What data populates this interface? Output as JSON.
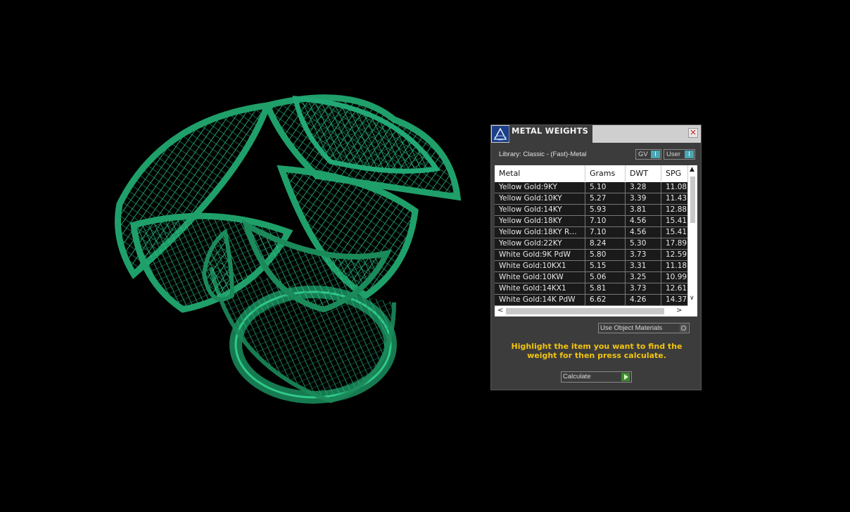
{
  "dialog": {
    "title": "METAL WEIGHTS",
    "close_glyph": "×",
    "library_label": "Library: Classic - (Fast)-Metal",
    "gv_button": "GV",
    "user_button": "User",
    "indicator_glyph": "I",
    "columns": [
      "Metal",
      "Grams",
      "DWT",
      "SPG"
    ],
    "rows": [
      {
        "metal": "Yellow Gold:9KY",
        "grams": "5.10",
        "dwt": "3.28",
        "spg": "11.08"
      },
      {
        "metal": "Yellow Gold:10KY",
        "grams": "5.27",
        "dwt": "3.39",
        "spg": "11.43"
      },
      {
        "metal": "Yellow Gold:14KY",
        "grams": "5.93",
        "dwt": "3.81",
        "spg": "12.88"
      },
      {
        "metal": "Yellow Gold:18KY",
        "grams": "7.10",
        "dwt": "4.56",
        "spg": "15.41"
      },
      {
        "metal": "Yellow Gold:18KY R…",
        "grams": "7.10",
        "dwt": "4.56",
        "spg": "15.41"
      },
      {
        "metal": "Yellow Gold:22KY",
        "grams": "8.24",
        "dwt": "5.30",
        "spg": "17.89"
      },
      {
        "metal": "White Gold:9K PdW",
        "grams": "5.80",
        "dwt": "3.73",
        "spg": "12.59"
      },
      {
        "metal": "White Gold:10KX1",
        "grams": "5.15",
        "dwt": "3.31",
        "spg": "11.18"
      },
      {
        "metal": "White Gold:10KW",
        "grams": "5.06",
        "dwt": "3.25",
        "spg": "10.99"
      },
      {
        "metal": "White Gold:14KX1",
        "grams": "5.81",
        "dwt": "3.73",
        "spg": "12.61"
      },
      {
        "metal": "White Gold:14K PdW",
        "grams": "6.62",
        "dwt": "4.26",
        "spg": "14.37"
      }
    ],
    "use_object_materials": "Use Object Materials",
    "hint": "Highlight the item you want to find the weight for then press calculate.",
    "calculate_button": "Calculate",
    "scroll_up_glyph": "▲",
    "scroll_down_glyph": "∨",
    "scroll_left_glyph": "<",
    "scroll_right_glyph": ">"
  },
  "colors": {
    "model_green": "#1b8a5a",
    "hint_yellow": "#f1c40f",
    "indicator_teal": "#4aa8b4",
    "calculate_green": "#3c8a2f"
  }
}
